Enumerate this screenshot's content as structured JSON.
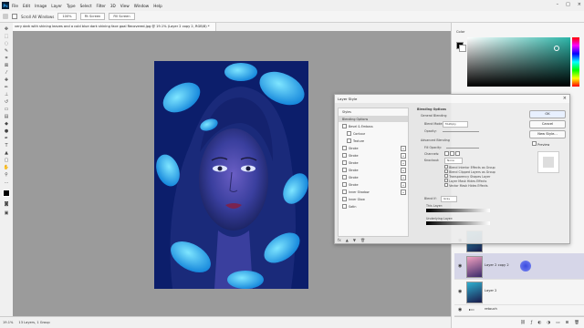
{
  "menubar": {
    "app_logo": "Ps",
    "items": [
      "File",
      "Edit",
      "Image",
      "Layer",
      "Type",
      "Select",
      "Filter",
      "3D",
      "View",
      "Window",
      "Help"
    ]
  },
  "optionsbar": {
    "scroll_all_windows": "Scroll All Windows",
    "zoom_value": "100%",
    "fit_screen": "Fit Screen",
    "fill_screen": "Fill Screen"
  },
  "document": {
    "tab_title": "very dark with shining leaves and a cold blue dark shining face goal Recovered.jpg @ 19.1% (Layer 2 copy 2, RGB/8) *"
  },
  "statusbar": {
    "zoom": "19.1%",
    "doc_info": "13 Layers, 1 Group"
  },
  "color_panel": {
    "tab": "Color"
  },
  "layers_panel": {
    "rows": [
      {
        "name": ""
      },
      {
        "name": "Layer 2 copy 2"
      },
      {
        "name": "Layer 2"
      },
      {
        "name": "retouch"
      }
    ]
  },
  "layer_style_dialog": {
    "title": "Layer Style",
    "close": "×",
    "styles_header": "Styles",
    "items": [
      {
        "label": "Blending Options",
        "checkbox": false,
        "plus": false
      },
      {
        "label": "Bevel & Emboss",
        "checkbox": true,
        "plus": false
      },
      {
        "label": "Contour",
        "checkbox": true,
        "plus": false
      },
      {
        "label": "Texture",
        "checkbox": true,
        "plus": false
      },
      {
        "label": "Stroke",
        "checkbox": true,
        "plus": true
      },
      {
        "label": "Stroke",
        "checkbox": true,
        "plus": true
      },
      {
        "label": "Stroke",
        "checkbox": true,
        "plus": true
      },
      {
        "label": "Stroke",
        "checkbox": true,
        "plus": true
      },
      {
        "label": "Stroke",
        "checkbox": true,
        "plus": true
      },
      {
        "label": "Stroke",
        "checkbox": true,
        "plus": true
      },
      {
        "label": "Inner Shadow",
        "checkbox": true,
        "plus": true
      },
      {
        "label": "Inner Glow",
        "checkbox": true,
        "plus": false
      },
      {
        "label": "Satin",
        "checkbox": true,
        "plus": false
      }
    ],
    "fx": "fx",
    "content": {
      "section": "Blending Options",
      "general": "General Blending",
      "blend_mode_label": "Blend Mode:",
      "blend_mode_value": "Multiply",
      "opacity_label": "Opacity:",
      "advanced": "Advanced Blending",
      "fill_opacity_label": "Fill Opacity:",
      "channels_label": "Channels:",
      "knockout_label": "Knockout:",
      "knockout_value": "None",
      "options": [
        "Blend Interior Effects as Group",
        "Blend Clipped Layers as Group",
        "Transparency Shapes Layer",
        "Layer Mask Hides Effects",
        "Vector Mask Hides Effects"
      ],
      "blend_if_label": "Blend If:",
      "blend_if_value": "Gray",
      "this_layer": "This Layer:",
      "underlying_layer": "Underlying Layer:"
    },
    "buttons": {
      "ok": "OK",
      "cancel": "Cancel",
      "new_style": "New Style...",
      "preview": "Preview"
    }
  },
  "colors": {
    "canvas_bg": "#9b9b9b",
    "accent": "#31a8ff"
  }
}
